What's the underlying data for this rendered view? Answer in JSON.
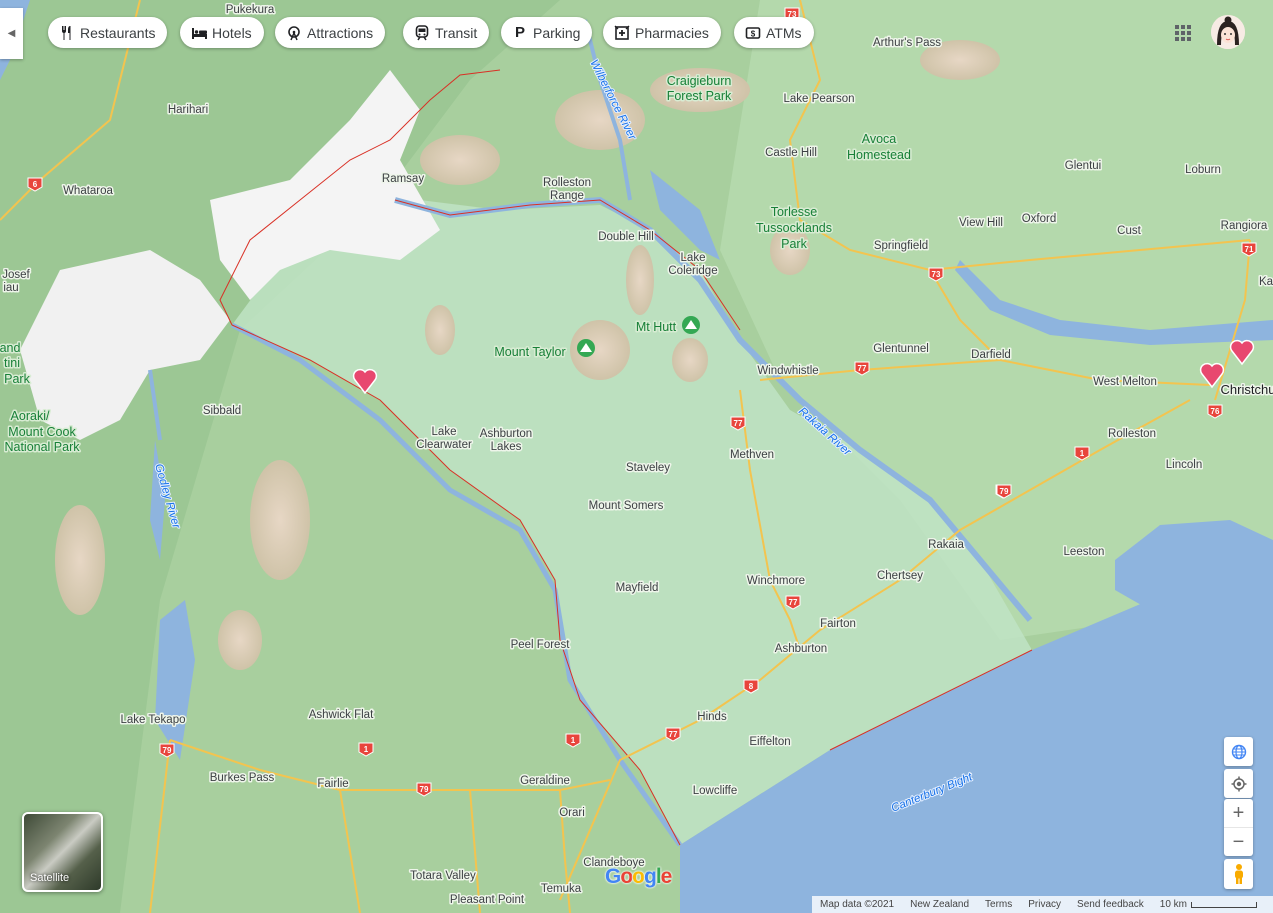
{
  "chips": [
    {
      "label": "Restaurants",
      "icon": "fork-knife-icon"
    },
    {
      "label": "Hotels",
      "icon": "bed-icon"
    },
    {
      "label": "Attractions",
      "icon": "ferris-wheel-icon"
    },
    {
      "label": "Transit",
      "icon": "train-icon"
    },
    {
      "label": "Parking",
      "icon": "parking-icon"
    },
    {
      "label": "Pharmacies",
      "icon": "pharmacy-icon"
    },
    {
      "label": "ATMs",
      "icon": "atm-icon"
    }
  ],
  "places": {
    "pukekura": "Pukekura",
    "harihari": "Harihari",
    "whataroa": "Whataroa",
    "ramsay": "Ramsay",
    "josef": "Josef",
    "iau": "iau",
    "and": "and",
    "tini": "tini",
    "park": "Park",
    "aoraki1": "Aoraki/",
    "aoraki2": "Mount Cook",
    "aoraki3": "National Park",
    "sibbald": "Sibbald",
    "godley": "Godley River",
    "lake_clearwater1": "Lake",
    "lake_clearwater2": "Clearwater",
    "ashburton_lakes1": "Ashburton",
    "ashburton_lakes2": "Lakes",
    "mount_taylor": "Mount Taylor",
    "mt_hutt": "Mt Hutt",
    "wilberforce": "Wilberforce River",
    "craigieburn1": "Craigieburn",
    "craigieburn2": "Forest Park",
    "arthurs_pass": "Arthur's Pass",
    "lake_pearson": "Lake Pearson",
    "castle_hill": "Castle Hill",
    "avoca1": "Avoca",
    "avoca2": "Homestead",
    "rolleston_range1": "Rolleston",
    "rolleston_range2": "Range",
    "torlesse1": "Torlesse",
    "torlesse2": "Tussocklands",
    "torlesse3": "Park",
    "double_hill": "Double Hill",
    "lake_coleridge1": "Lake",
    "lake_coleridge2": "Coleridge",
    "springfield": "Springfield",
    "glentui": "Glentui",
    "loburn": "Loburn",
    "view_hill": "View Hill",
    "oxford": "Oxford",
    "cust": "Cust",
    "rangiora": "Rangiora",
    "ka": "Ka",
    "glentunnel": "Glentunnel",
    "darfield": "Darfield",
    "west_melton": "West Melton",
    "christchurch": "Christchu",
    "windwhistle": "Windwhistle",
    "rakaia_river": "Rakaia River",
    "methven": "Methven",
    "staveley": "Staveley",
    "mount_somers": "Mount Somers",
    "rolleston": "Rolleston",
    "lincoln": "Lincoln",
    "leeston": "Leeston",
    "rakaia": "Rakaia",
    "chertsey": "Chertsey",
    "winchmore": "Winchmore",
    "mayfield": "Mayfield",
    "fairton": "Fairton",
    "ashburton": "Ashburton",
    "peel_forest": "Peel Forest",
    "hinds": "Hinds",
    "eiffelton": "Eiffelton",
    "lowcliffe": "Lowcliffe",
    "lake_tekapo": "Lake Tekapo",
    "ashwick_flat": "Ashwick Flat",
    "burkes_pass": "Burkes Pass",
    "fairlie": "Fairlie",
    "geraldine": "Geraldine",
    "orari": "Orari",
    "clandeboye": "Clandeboye",
    "temuka": "Temuka",
    "totara_valley": "Totara Valley",
    "pleasant_point": "Pleasant Point",
    "canterbury_bight": "Canterbury Bight"
  },
  "road_shields": [
    "73",
    "6",
    "71",
    "73",
    "77",
    "77",
    "77",
    "76",
    "1",
    "1",
    "1",
    "77",
    "1",
    "1",
    "79",
    "79",
    "79",
    "8"
  ],
  "colors": {
    "land": "#a9cfa0",
    "highlight": "#bfe3c4",
    "water": "#8eb4de",
    "road": "#f3c44f",
    "border": "#d93025",
    "river": "#8ab4f8"
  },
  "satellite_label": "Satellite",
  "google_logo": "Google",
  "footer": {
    "map_data": "Map data ©2021",
    "country": "New Zealand",
    "terms": "Terms",
    "privacy": "Privacy",
    "feedback": "Send feedback",
    "scale": "10 km"
  }
}
